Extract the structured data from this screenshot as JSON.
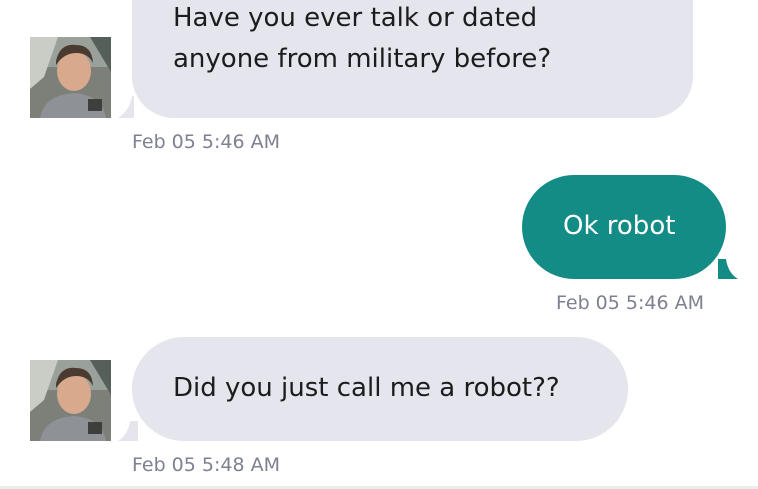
{
  "messages": [
    {
      "direction": "incoming",
      "lines": [
        "Have you ever talk or dated",
        "anyone from military before?"
      ],
      "timestamp": "Feb 05 5:46 AM"
    },
    {
      "direction": "outgoing",
      "text": "Ok robot",
      "timestamp": "Feb 05 5:46 AM"
    },
    {
      "direction": "incoming",
      "text": "Did you just call me a robot??",
      "timestamp": "Feb 05 5:48 AM"
    }
  ],
  "colors": {
    "incoming_bubble": "#e4e5ed",
    "outgoing_bubble": "#138c85",
    "timestamp_text": "#7d8190"
  },
  "icons": {
    "avatar": "user-photo-avatar"
  }
}
